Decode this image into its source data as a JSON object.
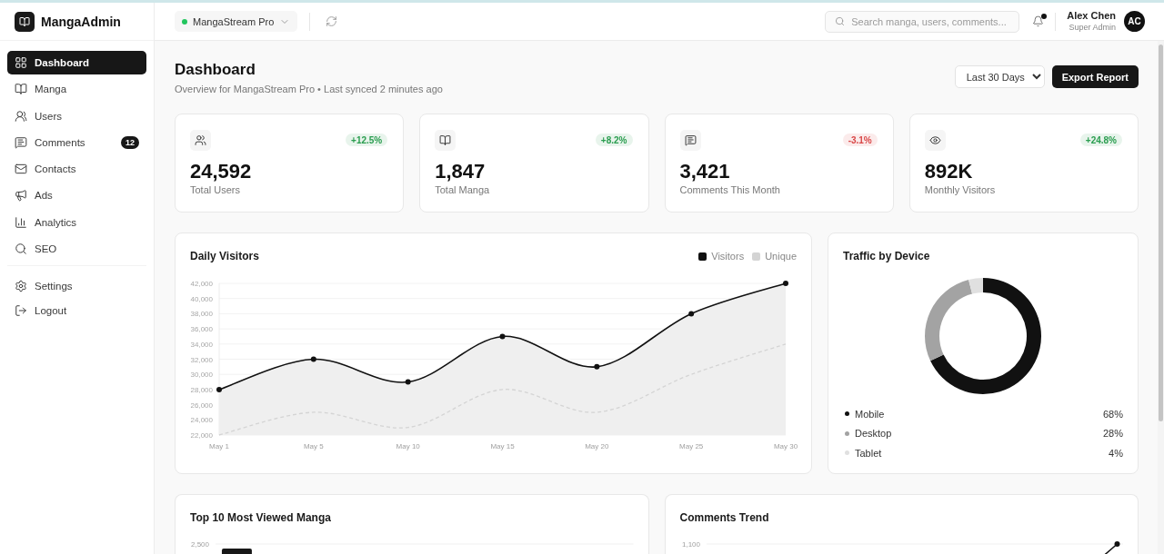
{
  "sidebar": {
    "app_name": "MangaAdmin",
    "nav": [
      {
        "label": "Dashboard",
        "selected": true
      },
      {
        "label": "Manga",
        "selected": false
      },
      {
        "label": "Users",
        "selected": false
      },
      {
        "label": "Comments",
        "selected": false,
        "badge": "12"
      },
      {
        "label": "Contacts",
        "selected": false
      },
      {
        "label": "Ads",
        "selected": false
      },
      {
        "label": "Analytics",
        "selected": false
      },
      {
        "label": "SEO",
        "selected": false
      }
    ],
    "footer_nav": [
      {
        "label": "Settings",
        "selected": false
      },
      {
        "label": "Logout",
        "selected": false
      }
    ]
  },
  "header": {
    "workspace": {
      "name": "MangaStream Pro",
      "online": true
    },
    "search": {
      "placeholder": "Search manga, users, comments..."
    },
    "notifications": {
      "unread": true
    },
    "user": {
      "name": "Alex Chen",
      "role": "Super Admin",
      "initials": "AC"
    }
  },
  "page": {
    "title": "Dashboard",
    "subtitle": "Overview for MangaStream Pro • Last synced 2 minutes ago",
    "date_range": {
      "value": "Last 30 Days"
    },
    "export_button": "Export Report"
  },
  "stats": [
    {
      "value": "24,592",
      "label": "Total Users",
      "change": "+12.5%",
      "color": "#2a9d4f"
    },
    {
      "value": "1,847",
      "label": "Total Manga",
      "change": "+8.2%",
      "color": "#2a9d4f"
    },
    {
      "value": "3,421",
      "label": "Comments This Month",
      "change": "-3.1%",
      "color": "#d94848"
    },
    {
      "value": "892K",
      "label": "Monthly Visitors",
      "change": "+24.8%",
      "color": "#2a9d4f"
    }
  ],
  "daily_visitors": {
    "chart_data": {
      "type": "line",
      "title": "Daily Visitors",
      "grid": true,
      "categories": [
        "May 1",
        "May 5",
        "May 10",
        "May 15",
        "May 20",
        "May 25",
        "May 30"
      ],
      "series": [
        {
          "name": "Visitors",
          "type": "area",
          "color": "#111111",
          "line_style": "solid",
          "marker": true,
          "values": [
            28000,
            32000,
            29000,
            35000,
            31000,
            38000,
            42000
          ]
        },
        {
          "name": "Unique",
          "type": "line",
          "color": "#d4d4d4",
          "line_style": "dashed",
          "marker": false,
          "values": [
            22000,
            25000,
            23000,
            28000,
            25000,
            30000,
            34000
          ]
        }
      ],
      "ylim": [
        22000,
        42000
      ],
      "yticks": [
        {
          "value": 22000,
          "label": "22,000"
        },
        {
          "value": 24000,
          "label": "24,000"
        },
        {
          "value": 26000,
          "label": "26,000"
        },
        {
          "value": 28000,
          "label": "28,000"
        },
        {
          "value": 30000,
          "label": "30,000"
        },
        {
          "value": 32000,
          "label": "32,000"
        },
        {
          "value": 34000,
          "label": "34,000"
        },
        {
          "value": 36000,
          "label": "36,000"
        },
        {
          "value": 38000,
          "label": "38,000"
        },
        {
          "value": 40000,
          "label": "40,000"
        },
        {
          "value": 42000,
          "label": "42,000"
        }
      ]
    }
  },
  "traffic_by_device": {
    "chart_data": {
      "type": "donut",
      "title": "Traffic by Device",
      "categories": [
        "Mobile",
        "Desktop",
        "Tablet"
      ],
      "values": [
        68,
        28,
        4
      ]
    },
    "legend": [
      {
        "value": "68%",
        "color": "#111111"
      },
      {
        "value": "28%",
        "color": "#a3a3a3"
      },
      {
        "value": "4%",
        "color": "#e0e0e0"
      }
    ]
  },
  "top_manga": {
    "title": "Top 10 Most Viewed Manga",
    "axis_label": "2,500"
  },
  "comments_trend": {
    "title": "Comments Trend",
    "axis_label": "1,100"
  }
}
